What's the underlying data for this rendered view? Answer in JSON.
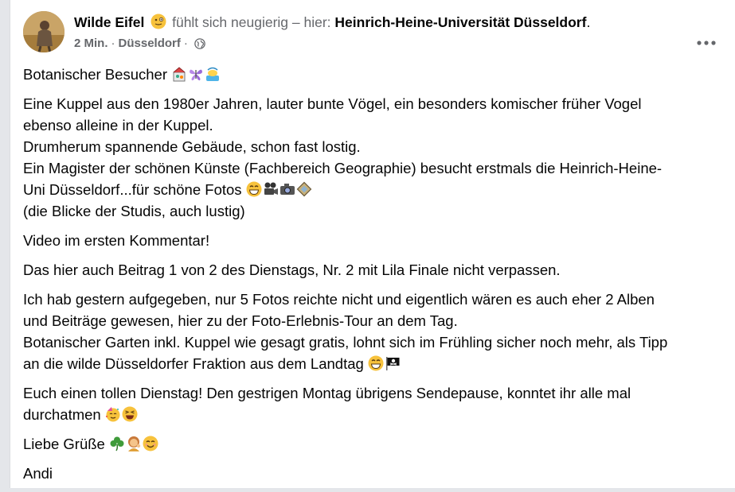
{
  "post": {
    "author": "Wilde Eifel",
    "feeling_text": "fühlt sich neugierig – hier:",
    "place": "Heinrich-Heine-Universität Düsseldorf",
    "place_suffix": ".",
    "time": "2 Min.",
    "location": "Düsseldorf",
    "separator": "·",
    "audience_icon": "globe-icon",
    "feeling_icon": "curious-face-icon",
    "more_icon": "more-options-icon"
  },
  "text": {
    "p1": "Botanischer Besucher",
    "p2_l1": "Eine Kuppel aus den 1980er Jahren, lauter bunte Vögel, ein besonders komischer früher Vogel",
    "p2_l2": "ebenso alleine in der Kuppel.",
    "p2_l3": "Drumherum spannende Gebäude, schon fast lostig.",
    "p2_l4": "Ein Magister der schönen Künste (Fachbereich Geographie) besucht erstmals die Heinrich-Heine-",
    "p2_l5": "Uni Düsseldorf...für schöne Fotos",
    "p2_l6": "(die Blicke der Studis, auch lustig)",
    "p3": "Video im ersten Kommentar!",
    "p4": "Das hier auch Beitrag 1 von 2 des Dienstags, Nr. 2 mit Lila Finale nicht verpassen.",
    "p5_l1": "Ich hab gestern aufgegeben, nur 5 Fotos reichte nicht und eigentlich wären es auch eher 2 Alben",
    "p5_l2": "und Beiträge gewesen, hier zu der Foto-Erlebnis-Tour an dem Tag.",
    "p5_l3": "Botanischer Garten inkl. Kuppel wie gesagt gratis, lohnt sich im Frühling sicher noch mehr, als Tipp",
    "p5_l4": "an die wilde Düsseldorfer Fraktion aus dem Landtag",
    "p6_l1": "Euch einen tollen Dienstag! Den gestrigen Montag übrigens Sendepause, konntet ihr alle mal",
    "p6_l2": "durchatmen",
    "p7": "Liebe Grüße",
    "p8": "Andi"
  },
  "emoji_icons": {
    "p1": [
      "artist-icon",
      "butterfly-icon",
      "bird-in-cage-icon"
    ],
    "p2": [
      "grin-icon",
      "movie-camera-icon",
      "camera-icon",
      "frame-icon"
    ],
    "p5": [
      "grin-icon",
      "pirate-flag-icon"
    ],
    "p6": [
      "party-face-icon",
      "laughing-face-icon"
    ],
    "p7": [
      "shamrock-icon",
      "person-icon",
      "smile-icon"
    ]
  }
}
